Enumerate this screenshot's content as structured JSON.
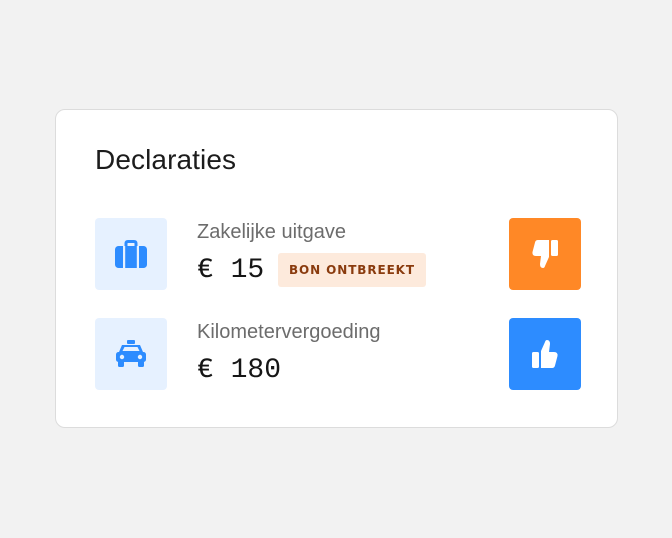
{
  "card": {
    "title": "Declaraties"
  },
  "expenses": [
    {
      "label": "Zakelijke uitgave",
      "amount": "€ 15",
      "badge": "BON ONTBREEKT",
      "icon": "briefcase-icon",
      "action": "thumbs-down",
      "action_color": "#ff8826"
    },
    {
      "label": "Kilometervergoeding",
      "amount": "€ 180",
      "icon": "car-icon",
      "action": "thumbs-up",
      "action_color": "#2d8cff"
    }
  ],
  "colors": {
    "icon_blue": "#2d8cff",
    "icon_tile_bg": "#e6f1ff",
    "reject": "#ff8826",
    "approve": "#2d8cff",
    "badge_bg": "#fdeadc",
    "badge_text": "#8a3b0e"
  }
}
